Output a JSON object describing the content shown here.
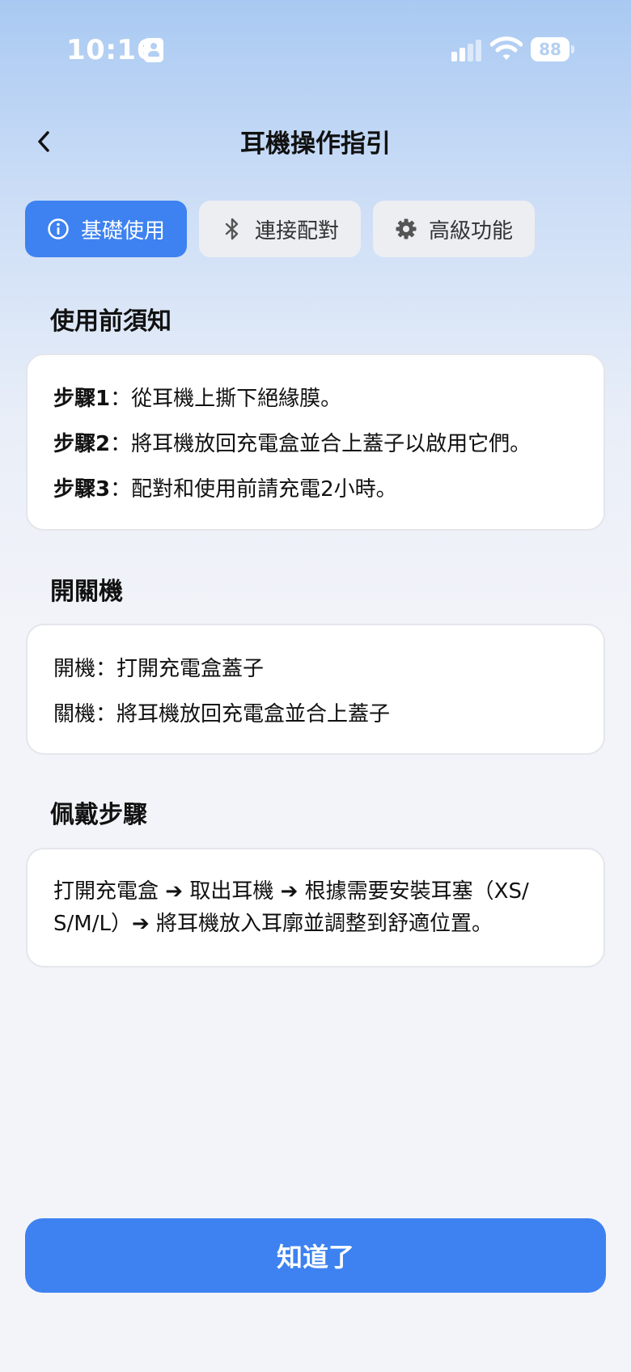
{
  "status_bar": {
    "time": "10:16",
    "battery": "88"
  },
  "nav": {
    "title": "耳機操作指引"
  },
  "tabs": [
    {
      "label": "基礎使用",
      "icon": "info-icon",
      "active": true
    },
    {
      "label": "連接配對",
      "icon": "bluetooth-icon",
      "active": false
    },
    {
      "label": "高級功能",
      "icon": "gear-icon",
      "active": false
    }
  ],
  "sections": {
    "before_use": {
      "title": "使用前須知",
      "steps": [
        {
          "label": "步驟1",
          "sep": "：",
          "text": "從耳機上撕下絕緣膜。"
        },
        {
          "label": "步驟2",
          "sep": "：",
          "text": "將耳機放回充電盒並合上蓋子以啟用它們。"
        },
        {
          "label": "步驟3",
          "sep": "：",
          "text": "配對和使用前請充電2小時。"
        }
      ]
    },
    "power": {
      "title": "開關機",
      "items": [
        {
          "label": "開機",
          "sep": "：",
          "text": "打開充電盒蓋子"
        },
        {
          "label": "關機",
          "sep": "：",
          "text": "將耳機放回充電盒並合上蓋子"
        }
      ]
    },
    "wearing": {
      "title": "佩戴步驟",
      "line1": "打開充電盒 ➔ 取出耳機 ➔ 根據需要安裝耳塞（XS/",
      "line2": "S/M/L）➔ 將耳機放入耳廓並調整到舒適位置。"
    }
  },
  "footer": {
    "ok_label": "知道了"
  },
  "colors": {
    "accent": "#3d82f0",
    "tab_inactive": "#eceef2"
  }
}
